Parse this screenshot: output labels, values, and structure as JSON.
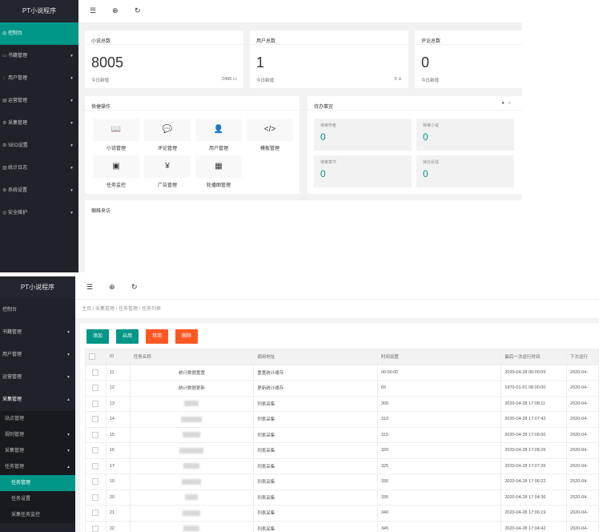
{
  "panel1": {
    "logo": "PT小说程序",
    "menu": [
      {
        "icon": "◎",
        "label": "控制台",
        "active": true
      },
      {
        "icon": "▭",
        "label": "书籍管理"
      },
      {
        "icon": "◌",
        "label": "用户管理"
      },
      {
        "icon": "▤",
        "label": "运营管理"
      },
      {
        "icon": "⚙",
        "label": "采集管理"
      },
      {
        "icon": "⚙",
        "label": "SEO设置"
      },
      {
        "icon": "▥",
        "label": "统计日志"
      },
      {
        "icon": "⚙",
        "label": "系统设置"
      },
      {
        "icon": "◎",
        "label": "安全维护"
      }
    ],
    "topbar_icons": [
      "menu-icon",
      "globe-icon",
      "refresh-icon"
    ],
    "stats": [
      {
        "title": "小说总数",
        "value": "8005",
        "sub": "今日新增",
        "right": "2495 ▭"
      },
      {
        "title": "用户总数",
        "value": "1",
        "sub": "今日新增",
        "right": "0 ♙"
      },
      {
        "title": "评论总数",
        "value": "0",
        "sub": "今日新增",
        "right": ""
      }
    ],
    "quick": {
      "title": "快捷操作",
      "items": [
        {
          "glyph": "📖",
          "label": "小说管理"
        },
        {
          "glyph": "💬",
          "label": "评论管理"
        },
        {
          "glyph": "👤",
          "label": "用户管理"
        },
        {
          "glyph": "</>",
          "label": "模板管理"
        },
        {
          "glyph": "▣",
          "label": "任务监控"
        },
        {
          "glyph": "¥",
          "label": "广告管理"
        },
        {
          "glyph": "▦",
          "label": "轮播图管理"
        }
      ]
    },
    "todo": {
      "title": "待办事宜",
      "items": [
        {
          "label": "待审作者",
          "value": "0"
        },
        {
          "label": "待审小说",
          "value": "0"
        },
        {
          "label": "待审章节",
          "value": "0"
        },
        {
          "label": "待办反馈",
          "value": "0"
        }
      ]
    },
    "visitors": {
      "title": "蜘蛛来访"
    }
  },
  "panel2": {
    "logo": "PT小说程序",
    "menu": [
      {
        "type": "item",
        "label": "控制台",
        "arrow": ""
      },
      {
        "type": "item",
        "label": "书籍管理",
        "arrow": "▼"
      },
      {
        "type": "item",
        "label": "用户管理",
        "arrow": "▼"
      },
      {
        "type": "item",
        "label": "运营管理",
        "arrow": "▼"
      },
      {
        "type": "item",
        "label": "采集管理",
        "arrow": "▲"
      },
      {
        "type": "sub",
        "label": "站点管理",
        "arrow": ""
      },
      {
        "type": "sub",
        "label": "规则管理",
        "arrow": "▼"
      },
      {
        "type": "sub",
        "label": "采集管理",
        "arrow": "▼"
      },
      {
        "type": "sub",
        "label": "任务管理",
        "arrow": "▲"
      },
      {
        "type": "active",
        "label": "任务管理",
        "arrow": ""
      },
      {
        "type": "deep",
        "label": "任务设置",
        "arrow": ""
      },
      {
        "type": "deep",
        "label": "采集任务监控",
        "arrow": ""
      }
    ],
    "breadcrumb": "主页 / 采集管理 / 任务管理 / 任务列表",
    "buttons": [
      {
        "label": "添加",
        "color": "#009688"
      },
      {
        "label": "启用",
        "color": "#009688"
      },
      {
        "label": "禁用",
        "color": "#FF5722"
      },
      {
        "label": "删除",
        "color": "#FF5722"
      }
    ],
    "table": {
      "headers": [
        "",
        "ID",
        "任务名称",
        "调用地址",
        "时间设置",
        "最后一次运行时间",
        "下次运行"
      ],
      "rows": [
        {
          "id": "11",
          "name": "统计数据重置",
          "addr": "重置统计缓存",
          "time": "00:00:00",
          "last": "2020-04-28 00:00:09",
          "next": "2020-04-"
        },
        {
          "id": "12",
          "name": "统计数据更新",
          "addr": "更新统计缓存",
          "time": "60",
          "last": "1970-01-01 08:00:00",
          "next": "2020-04-"
        },
        {
          "id": "13",
          "name": "",
          "addr": "列表采集",
          "time": "300",
          "last": "2020-04-28 17:08:11",
          "next": "2020-04-"
        },
        {
          "id": "14",
          "name": "",
          "addr": "列表采集",
          "time": "310",
          "last": "2020-04-28 17:07:42",
          "next": "2020-04-"
        },
        {
          "id": "15",
          "name": "",
          "addr": "列表采集",
          "time": "315",
          "last": "2020-04-28 17:06:00",
          "next": "2020-04-"
        },
        {
          "id": "16",
          "name": "",
          "addr": "列表采集",
          "time": "320",
          "last": "2020-04-28 17:08:26",
          "next": "2020-04-"
        },
        {
          "id": "17",
          "name": "",
          "addr": "列表采集",
          "time": "325",
          "last": "2020-04-28 17:07:26",
          "next": "2020-04-"
        },
        {
          "id": "19",
          "name": "",
          "addr": "列表采集",
          "time": "330",
          "last": "2020-04-28 17:06:22",
          "next": "2020-04-"
        },
        {
          "id": "20",
          "name": "",
          "addr": "列表采集",
          "time": "335",
          "last": "2020-04-28 17:04:36",
          "next": "2020-04-"
        },
        {
          "id": "21",
          "name": "",
          "addr": "列表采集",
          "time": "340",
          "last": "2020-04-28 17:06:19",
          "next": "2020-04-"
        },
        {
          "id": "22",
          "name": "",
          "addr": "列表采集",
          "time": "345",
          "last": "2020-04-28 17:04:42",
          "next": "2020-04-"
        }
      ]
    }
  }
}
